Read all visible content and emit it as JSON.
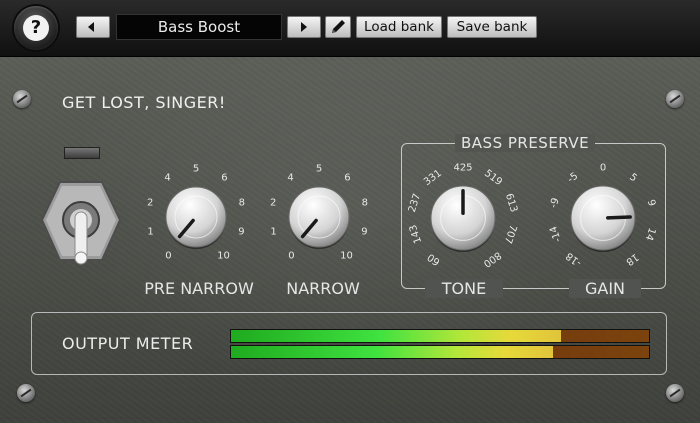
{
  "toolbar": {
    "help_glyph": "?",
    "preset_name": "Bass Boost",
    "load_bank_label": "Load bank",
    "save_bank_label": "Save bank",
    "icons": [
      "question-icon",
      "arrow-left-icon",
      "arrow-right-icon",
      "pencil-icon"
    ]
  },
  "panel": {
    "title": "GET LOST, SINGER!",
    "pre_narrow": {
      "label": "PRE NARROW",
      "ticks": [
        "0",
        "1",
        "2",
        "4",
        "5",
        "6",
        "8",
        "9",
        "10"
      ]
    },
    "narrow": {
      "label": "NARROW",
      "ticks": [
        "0",
        "1",
        "2",
        "4",
        "5",
        "6",
        "8",
        "9",
        "10"
      ]
    },
    "bass_preserve": {
      "title": "BASS PRESERVE",
      "tone": {
        "label": "TONE",
        "ticks": [
          "60",
          "143",
          "237",
          "331",
          "425",
          "519",
          "613",
          "707",
          "800"
        ]
      },
      "gain": {
        "label": "GAIN",
        "ticks": [
          "-18",
          "-14",
          "-9",
          "-5",
          "0",
          "5",
          "9",
          "14",
          "18"
        ]
      }
    },
    "output_meter": {
      "label": "OUTPUT METER",
      "left_level": 0.79,
      "right_level": 0.77
    }
  },
  "colors": {
    "panel": "#4f524c",
    "meter_green": "#3fe23f",
    "meter_yellow": "#e6d93a",
    "meter_red": "#8a2a10"
  }
}
